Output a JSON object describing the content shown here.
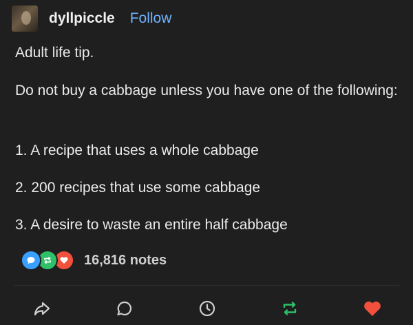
{
  "post": {
    "author": {
      "username": "dyllpiccle",
      "follow_label": "Follow"
    },
    "body": {
      "paragraph1": "Adult life tip.",
      "paragraph2": "Do not buy a cabbage unless you have one of the following:",
      "list": [
        "1. A recipe that uses a whole cabbage",
        "2. 200 recipes that use some cabbage",
        "3. A desire to waste an entire half cabbage"
      ]
    },
    "notes": {
      "count_label": "16,816 notes",
      "bubble_icons": [
        "reply-bubble-icon",
        "reblog-bubble-icon",
        "like-bubble-icon"
      ]
    },
    "actions": [
      "share-icon",
      "reply-icon",
      "clock-icon",
      "reblog-icon",
      "like-icon"
    ]
  },
  "colors": {
    "background": "#1f1f1f",
    "text": "#ebebeb",
    "follow": "#6fb3ff",
    "reply_blue": "#3aa0ff",
    "reblog_green": "#2fc16a",
    "like_red": "#f0503c"
  }
}
